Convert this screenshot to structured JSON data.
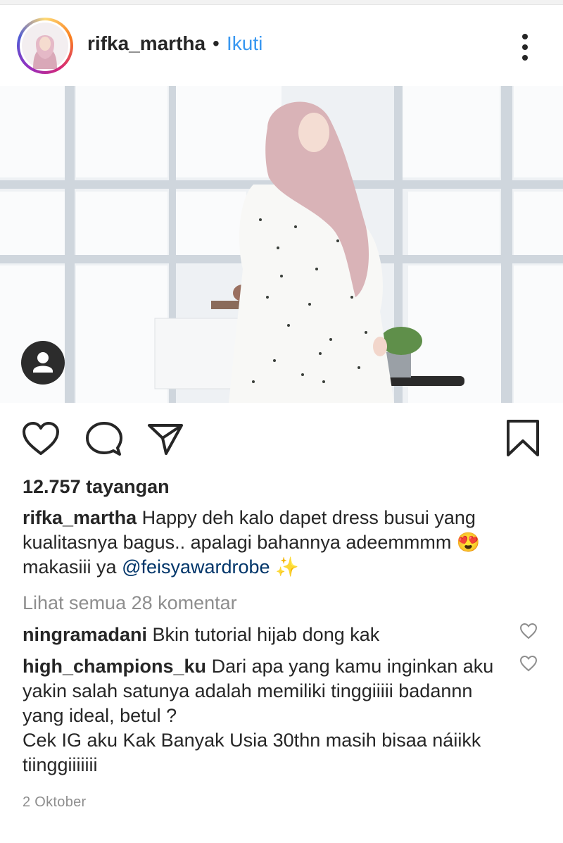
{
  "post": {
    "username": "rifka_martha",
    "separator": "•",
    "follow_label": "Ikuti",
    "more_icon": "more-vertical-icon",
    "views": "12.757 tayangan",
    "caption": {
      "username": "rifka_martha",
      "text_1": "Happy deh kalo dapet dress busui yang kualitasnya bagus.. apalagi bahannya adeemmmm",
      "emoji_1": "😍",
      "text_2": "makasiii ya",
      "mention": "@feisyawardrobe",
      "emoji_2": "✨"
    },
    "view_all_comments": "Lihat semua 28 komentar",
    "comments": [
      {
        "username": "ningramadani",
        "text": "Bkin tutorial hijab dong kak"
      },
      {
        "username": "high_champions_ku",
        "text": "Dari apa yang kamu inginkan aku yakin salah satunya adalah memiliki tinggiiiii badannn yang ideal, betul ?",
        "text_2": "Cek IG aku Kak Banyak Usia 30thn masih bisaa náiikk tiinggiiiiiii"
      }
    ],
    "date": "2 Oktober"
  },
  "colors": {
    "text": "#262626",
    "link": "#3897f0",
    "muted": "#8e8e8e",
    "mention": "#003569"
  }
}
